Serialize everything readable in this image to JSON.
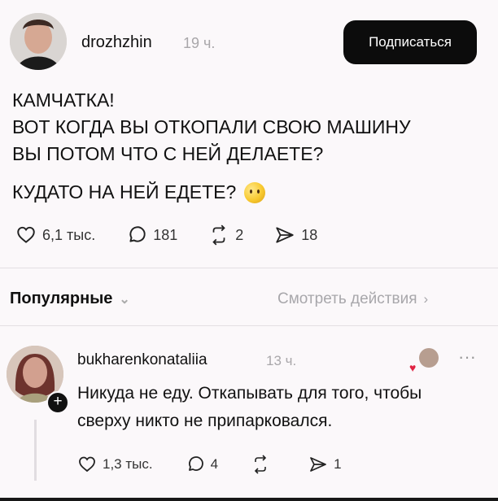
{
  "post": {
    "author": "drozhzhin",
    "time": "19 ч.",
    "follow_label": "Подписаться",
    "lines": [
      "КАМЧАТКА!",
      "ВОТ КОГДА ВЫ ОТКОПАЛИ СВОЮ МАШИНУ",
      "ВЫ ПОТОМ ЧТО С НЕЙ ДЕЛАЕТЕ?"
    ],
    "question": "КУДАТО НА НЕЙ ЕДЕТЕ?",
    "likes": "6,1 тыс.",
    "comments": "181",
    "reposts": "2",
    "shares": "18"
  },
  "sort": {
    "label": "Популярные",
    "view_actions": "Смотреть действия"
  },
  "reply": {
    "author": "bukharenkonataliia",
    "time": "13 ч.",
    "text": "Никуда не еду. Откапывать для того, чтобы сверху никто не припарковался.",
    "likes": "1,3 тыс.",
    "comments": "4",
    "shares": "1"
  },
  "icons": {
    "heart": "heart-icon",
    "comment": "comment-icon",
    "repost": "repost-icon",
    "share": "share-icon"
  }
}
